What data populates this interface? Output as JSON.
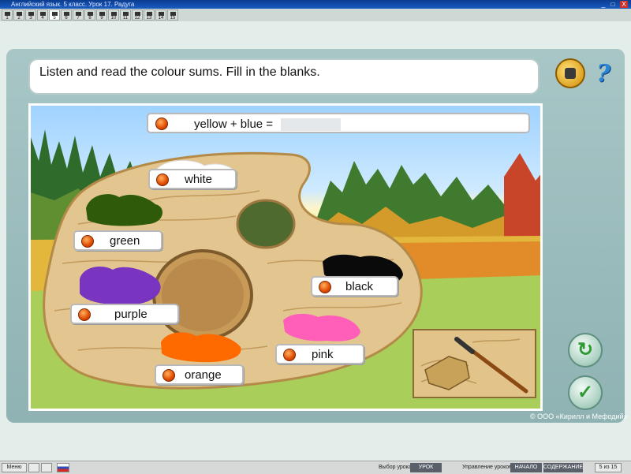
{
  "window": {
    "title": "Английский язык. 5 класс. Урок 17. Радуга",
    "buttons": [
      "_",
      "□",
      "X"
    ]
  },
  "lesson_tabs": [
    "1",
    "2",
    "3",
    "4",
    "5",
    "6",
    "7",
    "8",
    "9",
    "10",
    "11",
    "12",
    "13",
    "14",
    "15"
  ],
  "active_tab": "5",
  "instruction": "Listen and read the colour sums. Fill in the blanks.",
  "help_label": "?",
  "question": {
    "text": "yellow + blue =",
    "answer_value": ""
  },
  "words": {
    "white": "white",
    "green": "green",
    "purple": "purple",
    "orange": "orange",
    "black": "black",
    "pink": "pink"
  },
  "copyright": "© ООО «Кирилл и Мефодий»",
  "buttons": {
    "reset": "↻",
    "check": "✓"
  },
  "taskbar": {
    "menu": "Меню",
    "lesson_select_label": "Выбор урока:",
    "lesson_button": "УРОК",
    "lesson_control_label": "Управление уроком:",
    "start": "НАЧАЛО",
    "contents": "СОДЕРЖАНИЕ",
    "page_counter": "5 из 15"
  },
  "colors": {
    "white": "#ffffff",
    "green": "#2e5a0a",
    "purple": "#7a35c0",
    "orange": "#ff6a00",
    "black": "#0a0a0a",
    "pink": "#ff5fb8",
    "palette_wood": "#e3c68f",
    "frame": "#9dbfbf"
  }
}
